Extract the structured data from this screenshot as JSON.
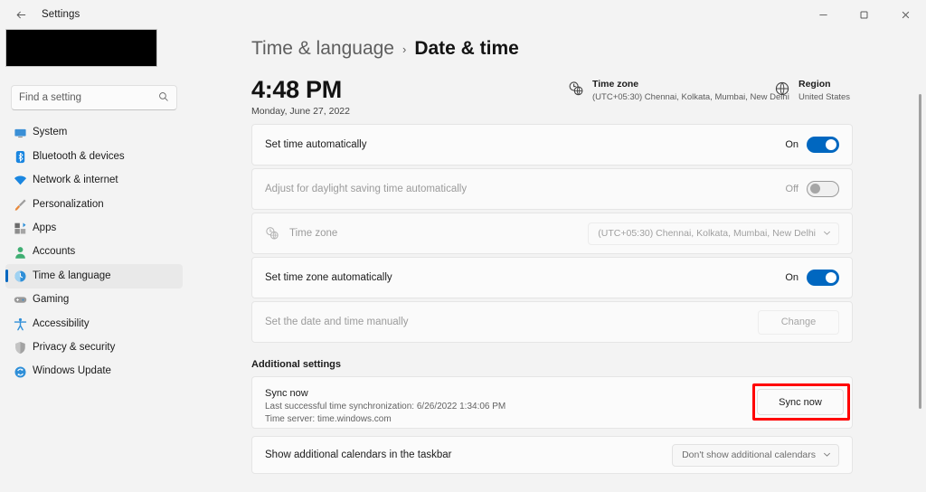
{
  "window": {
    "title": "Settings",
    "back_icon": "back-arrow-icon",
    "minimize": "–",
    "maximize": "□",
    "close": "✕"
  },
  "sidebar": {
    "account_redacted": "",
    "search": {
      "placeholder": "Find a setting",
      "value": "",
      "icon": "search-icon"
    },
    "items": [
      {
        "label": "System",
        "icon": "system-monitor-icon",
        "active": false
      },
      {
        "label": "Bluetooth & devices",
        "icon": "bluetooth-icon",
        "active": false
      },
      {
        "label": "Network & internet",
        "icon": "wifi-icon",
        "active": false
      },
      {
        "label": "Personalization",
        "icon": "paintbrush-icon",
        "active": false
      },
      {
        "label": "Apps",
        "icon": "apps-grid-icon",
        "active": false
      },
      {
        "label": "Accounts",
        "icon": "person-icon",
        "active": false
      },
      {
        "label": "Time & language",
        "icon": "clock-globe-icon",
        "active": true
      },
      {
        "label": "Gaming",
        "icon": "gamepad-icon",
        "active": false
      },
      {
        "label": "Accessibility",
        "icon": "accessibility-person-icon",
        "active": false
      },
      {
        "label": "Privacy & security",
        "icon": "shield-icon",
        "active": false
      },
      {
        "label": "Windows Update",
        "icon": "update-refresh-icon",
        "active": false
      }
    ]
  },
  "breadcrumb": {
    "parent": "Time & language",
    "separator": "›",
    "current": "Date & time"
  },
  "clock": {
    "time": "4:48 PM",
    "date": "Monday, June 27, 2022"
  },
  "info": {
    "timezone": {
      "icon": "clock-globe-icon",
      "title": "Time zone",
      "value": "(UTC+05:30) Chennai, Kolkata, Mumbai, New Delhi"
    },
    "region": {
      "icon": "globe-icon",
      "title": "Region",
      "value": "United States"
    }
  },
  "settings": {
    "set_time_auto": {
      "label": "Set time automatically",
      "state": "On",
      "toggle": "on"
    },
    "dst_auto": {
      "label": "Adjust for daylight saving time automatically",
      "state": "Off",
      "toggle": "off"
    },
    "timezone_row": {
      "label": "Time zone",
      "icon": "clock-globe-icon",
      "value": "(UTC+05:30) Chennai, Kolkata, Mumbai, New Delhi",
      "chevron": "⌄"
    },
    "set_tz_auto": {
      "label": "Set time zone automatically",
      "state": "On",
      "toggle": "on"
    },
    "set_manual": {
      "label": "Set the date and time manually",
      "button": "Change"
    }
  },
  "additional": {
    "heading": "Additional settings",
    "sync": {
      "title": "Sync now",
      "last_sync": "Last successful time synchronization: 6/26/2022 1:34:06 PM",
      "time_server": "Time server: time.windows.com",
      "button": "Sync now"
    },
    "calendars": {
      "label": "Show additional calendars in the taskbar",
      "value": "Don't show additional calendars",
      "chevron": "⌄"
    }
  },
  "colors": {
    "accent": "#0067c0",
    "highlight": "#ff0000",
    "page_bg": "#f3f3f3",
    "card_bg": "#fbfbfb"
  }
}
